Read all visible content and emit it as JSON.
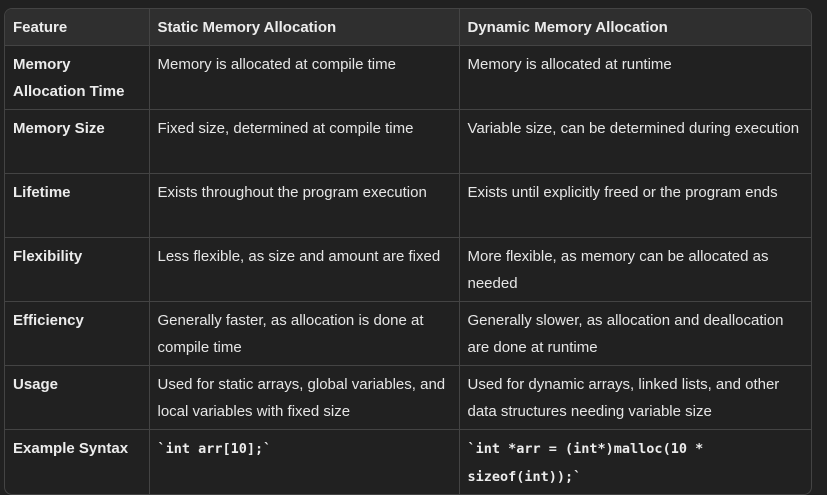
{
  "table": {
    "headers": [
      "Feature",
      "Static Memory Allocation",
      "Dynamic Memory Allocation"
    ],
    "rows": [
      {
        "feature": "Memory Allocation Time",
        "static": "Memory is allocated at compile time",
        "dynamic": "Memory is allocated at runtime"
      },
      {
        "feature": "Memory Size",
        "static": "Fixed size, determined at compile time",
        "dynamic": "Variable size, can be determined during execution"
      },
      {
        "feature": "Lifetime",
        "static": "Exists throughout the program execution",
        "dynamic": "Exists until explicitly freed or the program ends"
      },
      {
        "feature": "Flexibility",
        "static": "Less flexible, as size and amount are fixed",
        "dynamic": "More flexible, as memory can be allocated as needed"
      },
      {
        "feature": "Efficiency",
        "static": "Generally faster, as allocation is done at compile time",
        "dynamic": "Generally slower, as allocation and deallocation are done at runtime"
      },
      {
        "feature": "Usage",
        "static": "Used for static arrays, global variables, and local variables with fixed size",
        "dynamic": "Used for dynamic arrays, linked lists, and other data structures needing variable size"
      },
      {
        "feature": "Example Syntax",
        "static": "`int arr[10];`",
        "dynamic": "`int *arr = (int*)malloc(10 * sizeof(int));`"
      }
    ]
  }
}
